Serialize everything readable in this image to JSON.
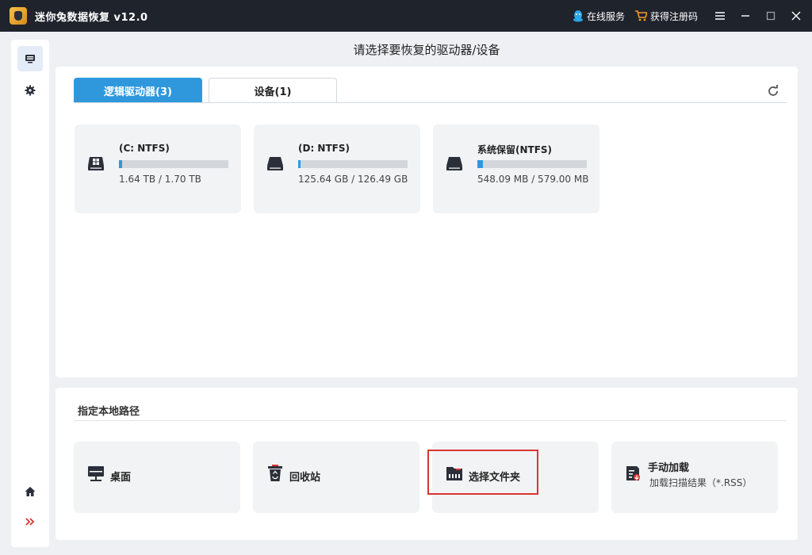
{
  "app": {
    "title": "迷你兔数据恢复 v12.0",
    "online_service": "在线服务",
    "get_code": "获得注册码"
  },
  "header": {
    "title": "请选择要恢复的驱动器/设备"
  },
  "tabs": [
    {
      "label": "逻辑驱动器(3)",
      "active": true
    },
    {
      "label": "设备(1)",
      "active": false
    }
  ],
  "drives": [
    {
      "name": "(C: NTFS)",
      "size": "1.64 TB / 1.70 TB",
      "icon": "windows-drive-icon",
      "used_fraction": 0.03
    },
    {
      "name": "(D: NTFS)",
      "size": "125.64 GB / 126.49 GB",
      "icon": "hard-drive-icon",
      "used_fraction": 0.0
    },
    {
      "name": "系统保留(NTFS)",
      "size": "548.09 MB / 579.00 MB",
      "icon": "hard-drive-icon",
      "used_fraction": 0.05
    }
  ],
  "local_path": {
    "title": "指定本地路径",
    "items": [
      {
        "label": "桌面",
        "icon": "desktop-icon"
      },
      {
        "label": "回收站",
        "icon": "recycle-bin-icon"
      },
      {
        "label": "选择文件夹",
        "icon": "folder-icon"
      },
      {
        "label": "手动加载",
        "sub": "加载扫描结果（*.RSS）",
        "icon": "load-file-icon"
      }
    ]
  },
  "colors": {
    "accent": "#2f98dc",
    "titlebar": "#1f232c",
    "highlight": "#d9362f"
  }
}
